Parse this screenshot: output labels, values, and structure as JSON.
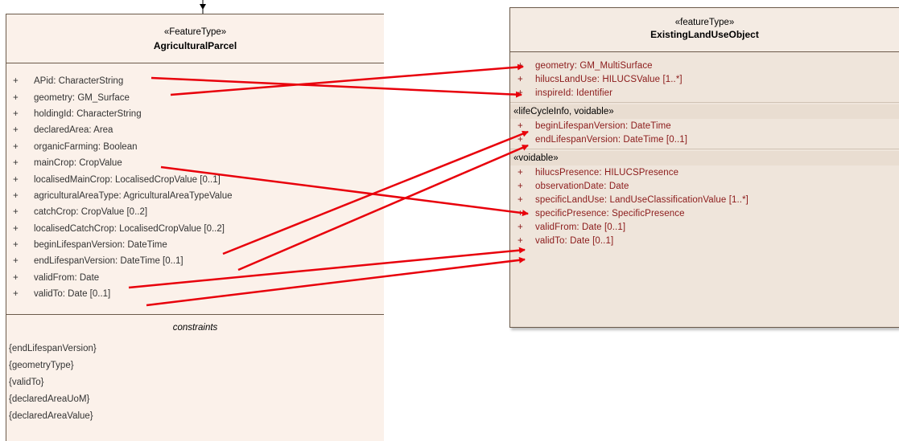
{
  "left_class": {
    "stereotype": "«FeatureType»",
    "name": "AgriculturalParcel",
    "attributes": [
      {
        "vis": "+",
        "text": "APid: CharacterString"
      },
      {
        "vis": "+",
        "text": "geometry: GM_Surface"
      },
      {
        "vis": "+",
        "text": "holdingId: CharacterString"
      },
      {
        "vis": "+",
        "text": "declaredArea: Area"
      },
      {
        "vis": "+",
        "text": "organicFarming: Boolean"
      },
      {
        "vis": "+",
        "text": "mainCrop: CropValue"
      },
      {
        "vis": "+",
        "text": "localisedMainCrop: LocalisedCropValue [0..1]"
      },
      {
        "vis": "+",
        "text": "agriculturalAreaType: AgriculturalAreaTypeValue"
      },
      {
        "vis": "+",
        "text": "catchCrop: CropValue [0..2]"
      },
      {
        "vis": "+",
        "text": "localisedCatchCrop: LocalisedCropValue [0..2]"
      },
      {
        "vis": "+",
        "text": "beginLifespanVersion: DateTime"
      },
      {
        "vis": "+",
        "text": "endLifespanVersion: DateTime [0..1]"
      },
      {
        "vis": "+",
        "text": "validFrom: Date"
      },
      {
        "vis": "+",
        "text": "validTo: Date [0..1]"
      }
    ],
    "constraints_title": "constraints",
    "constraints": [
      "{endLifespanVersion}",
      "{geometryType}",
      "{validTo}",
      "{declaredAreaUoM}",
      "{declaredAreaValue}"
    ]
  },
  "right_class": {
    "stereotype": "«featureType»",
    "name": "ExistingLandUseObject",
    "section1": [
      {
        "vis": "+",
        "text": "geometry: GM_MultiSurface"
      },
      {
        "vis": "+",
        "text": "hilucsLandUse: HILUCSValue [1..*]"
      },
      {
        "vis": "+",
        "text": "inspireId: Identifier"
      }
    ],
    "section2_title": "«lifeCycleInfo, voidable»",
    "section2": [
      {
        "vis": "+",
        "text": "beginLifespanVersion: DateTime"
      },
      {
        "vis": "+",
        "text": "endLifespanVersion: DateTime [0..1]"
      }
    ],
    "section3_title": "«voidable»",
    "section3": [
      {
        "vis": "+",
        "text": "hilucsPresence: HILUCSPresence"
      },
      {
        "vis": "+",
        "text": "observationDate: Date"
      },
      {
        "vis": "+",
        "text": "specificLandUse: LandUseClassificationValue [1..*]"
      },
      {
        "vis": "+",
        "text": "specificPresence: SpecificPresence"
      },
      {
        "vis": "+",
        "text": "validFrom: Date [0..1]"
      },
      {
        "vis": "+",
        "text": "validTo: Date [0..1]"
      }
    ]
  },
  "mappings": [
    {
      "from": "APid: CharacterString",
      "to": "inspireId: Identifier"
    },
    {
      "from": "geometry: GM_Surface",
      "to": "geometry: GM_MultiSurface"
    },
    {
      "from": "mainCrop: CropValue",
      "to": "specificLandUse: LandUseClassificationValue [1..*]"
    },
    {
      "from": "beginLifespanVersion: DateTime",
      "to": "beginLifespanVersion: DateTime"
    },
    {
      "from": "endLifespanVersion: DateTime [0..1]",
      "to": "endLifespanVersion: DateTime [0..1]"
    },
    {
      "from": "validFrom: Date",
      "to": "validFrom: Date [0..1]"
    },
    {
      "from": "validTo: Date [0..1]",
      "to": "validTo: Date [0..1]"
    }
  ],
  "colors": {
    "arrow": "#e8000b",
    "left_fill": "#fbf1ea",
    "right_fill": "#efe5db",
    "right_text": "#8b1a1a"
  }
}
